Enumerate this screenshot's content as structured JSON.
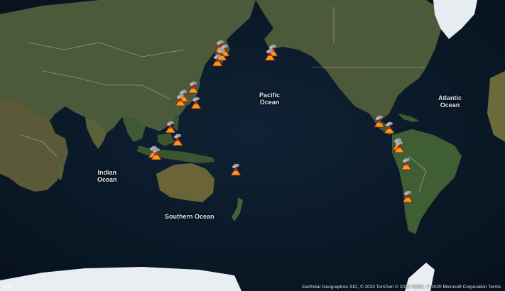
{
  "map": {
    "labels": {
      "pacific_line1": "Pacific",
      "pacific_line2": "Ocean",
      "atlantic_line1": "Atlantic",
      "atlantic_line2": "Ocean",
      "indian_line1": "Indian",
      "indian_line2": "Ocean",
      "southern": "Southern Ocean"
    },
    "attribution": "Earthstar Geographics SIO, © 2020 TomTom © 2020 HERE, © 2020 Microsoft Corporation  Terms",
    "logo": "Bing",
    "marker_icon": "volcano-icon",
    "colors": {
      "ocean": "#0b1826",
      "land": "#4a5a3a",
      "ice": "#e8eef2",
      "volcano_orange": "#f39a1d",
      "volcano_red": "#c62c1a",
      "borders": "#d8d8d8"
    }
  }
}
